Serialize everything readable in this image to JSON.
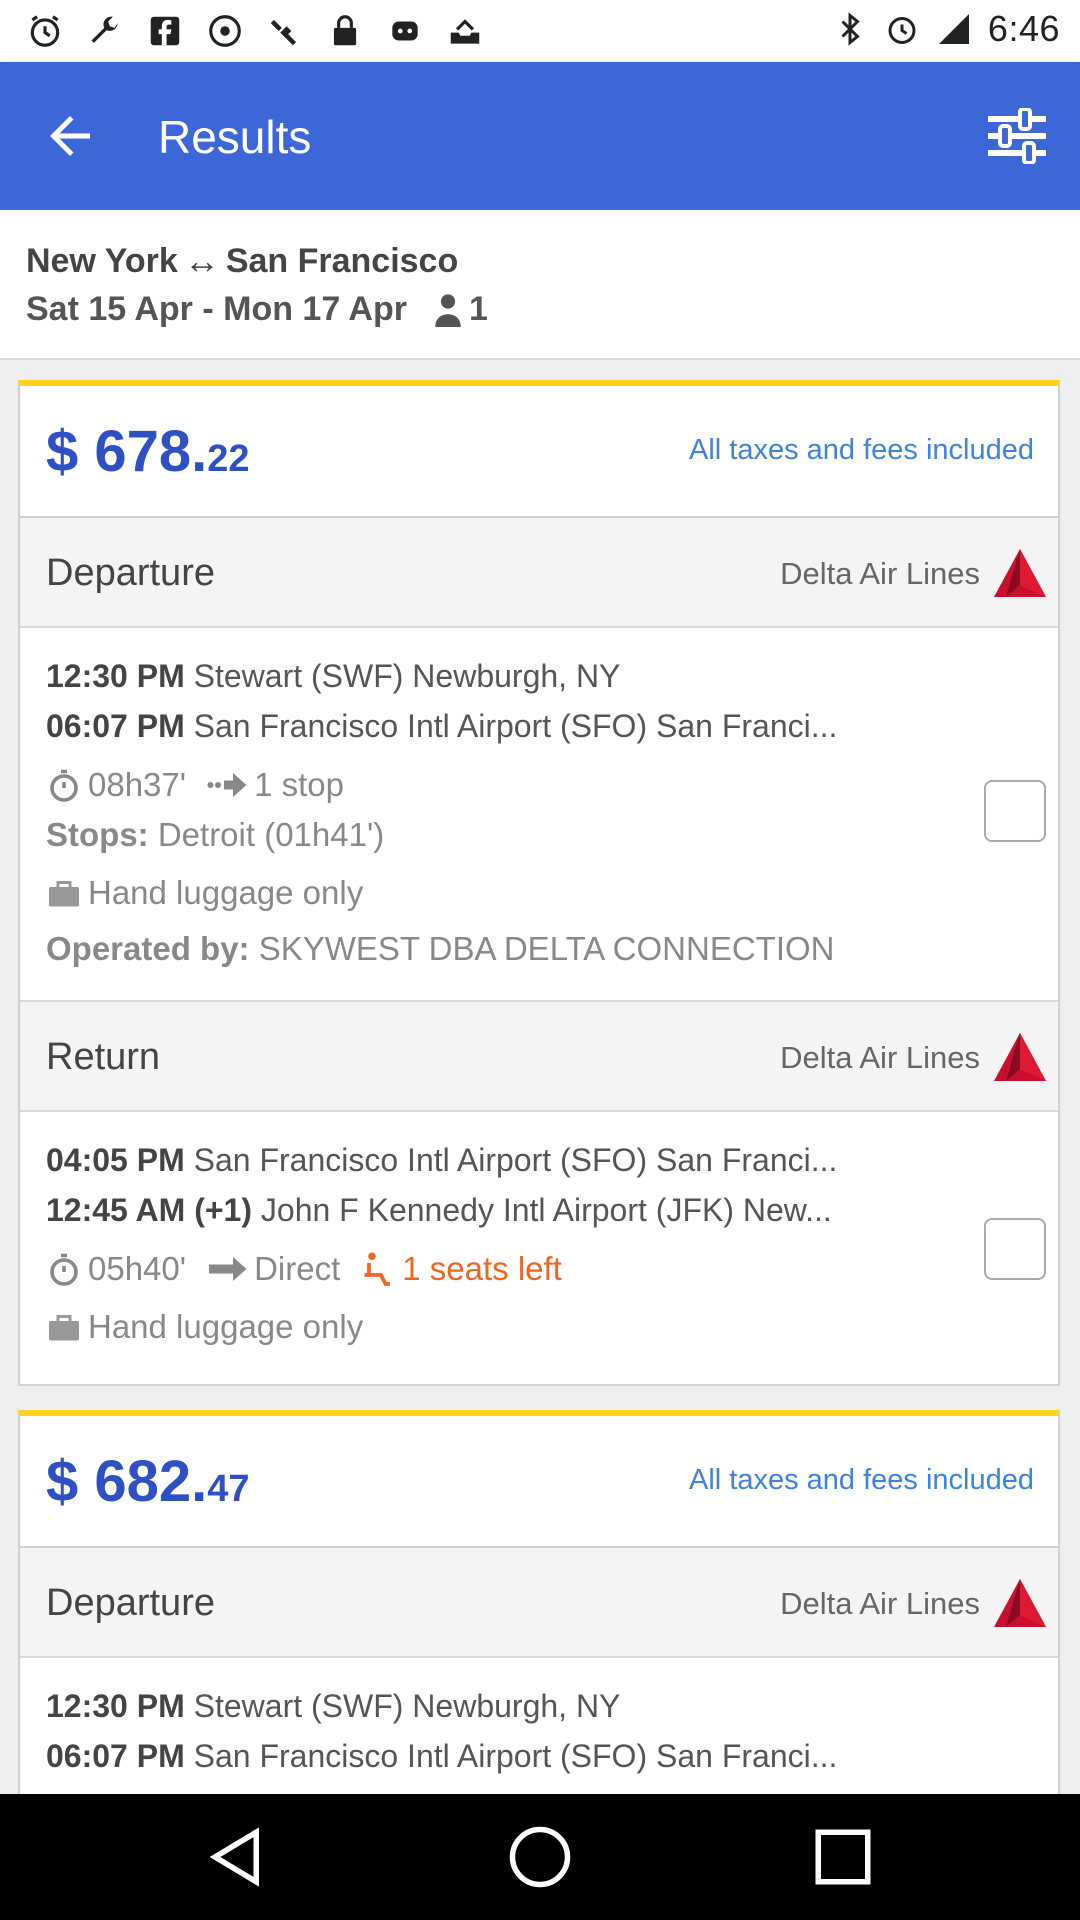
{
  "status_bar": {
    "time": "6:46",
    "left_icons": [
      "clock-icon",
      "wrench-icon",
      "facebook-icon",
      "fake-gps-icon",
      "satellite-icon",
      "lock-icon",
      "robot-icon",
      "mail-tray-icon"
    ],
    "right_icons": [
      "bluetooth-icon",
      "alarm-icon",
      "signal-icon"
    ]
  },
  "app_bar": {
    "title": "Results",
    "back_icon": "arrow-back-icon",
    "filter_icon": "tune-icon"
  },
  "summary": {
    "origin": "New York",
    "destination": "San Francisco",
    "dates": "Sat 15 Apr - Mon 17 Apr",
    "passengers": "1"
  },
  "results": [
    {
      "price_main": "$ 678.",
      "price_cents": "22",
      "taxes_note": "All taxes and fees included",
      "departure": {
        "title": "Departure",
        "airline": "Delta Air Lines",
        "dep_time": "12:30 PM",
        "dep_airport": "Stewart (SWF) Newburgh, NY",
        "arr_time": "06:07 PM",
        "arr_airport": "San Francisco Intl Airport (SFO) San Franci...",
        "duration": "08h37'",
        "stops_summary": "1 stop",
        "stops_label": "Stops:",
        "stops_detail": "Detroit (01h41')",
        "luggage": "Hand luggage only",
        "operated_label": "Operated by:",
        "operated_by": "SKYWEST DBA DELTA CONNECTION"
      },
      "return": {
        "title": "Return",
        "airline": "Delta Air Lines",
        "dep_time": "04:05 PM",
        "dep_airport": "San Francisco Intl Airport (SFO) San Franci...",
        "arr_time": "12:45 AM (+1)",
        "arr_airport": "John F Kennedy Intl Airport (JFK) New...",
        "duration": "05h40'",
        "stops_summary": "Direct",
        "seats_left": "1 seats left",
        "luggage": "Hand luggage only"
      }
    },
    {
      "price_main": "$ 682.",
      "price_cents": "47",
      "taxes_note": "All taxes and fees included",
      "departure": {
        "title": "Departure",
        "airline": "Delta Air Lines",
        "dep_time": "12:30 PM",
        "dep_airport": "Stewart (SWF) Newburgh, NY",
        "arr_time": "06:07 PM",
        "arr_airport": "San Francisco Intl Airport (SFO) San Franci..."
      }
    }
  ],
  "nav_bar": {
    "icons": [
      "back-triangle-icon",
      "home-circle-icon",
      "recents-square-icon"
    ]
  },
  "colors": {
    "app_bar": "#3d66d7",
    "price": "#2d50c4",
    "taxes": "#3d83e2",
    "card_accent": "#ffd21f",
    "seats_warning": "#f26522"
  }
}
